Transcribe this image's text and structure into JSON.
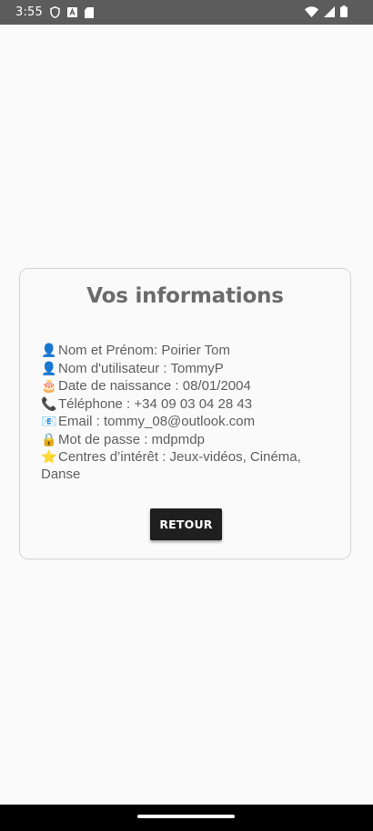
{
  "status_bar": {
    "time": "3:55",
    "left_icons": [
      "shield-icon",
      "a-icon",
      "sd-card-icon"
    ],
    "right_icons": [
      "wifi-icon",
      "signal-icon",
      "battery-icon"
    ]
  },
  "card": {
    "title": "Vos informations",
    "rows": [
      {
        "icon": "👤",
        "text": "Nom et Prénom: Poirier Tom"
      },
      {
        "icon": "👤",
        "text": "Nom d'utilisateur : TommyP"
      },
      {
        "icon": "🎂",
        "text": "Date de naissance : 08/01/2004"
      },
      {
        "icon": "📞",
        "text": "Téléphone : +34 09 03 04 28 43"
      },
      {
        "icon": "📧",
        "text": "Email : tommy_08@outlook.com"
      },
      {
        "icon": "🔒",
        "text": "Mot de passe : mdpmdp"
      },
      {
        "icon": "⭐",
        "text": "Centres d’intérêt : Jeux-vidéos, Cinéma,",
        "continuation": "Danse"
      }
    ],
    "back_button": "RETOUR"
  },
  "colors": {
    "status_bar": "#5c5c5c",
    "background": "#fafafa",
    "title": "#6b6b6b",
    "text": "#5f5f5f",
    "button": "#1f1f1f",
    "nav_bar": "#000000"
  }
}
